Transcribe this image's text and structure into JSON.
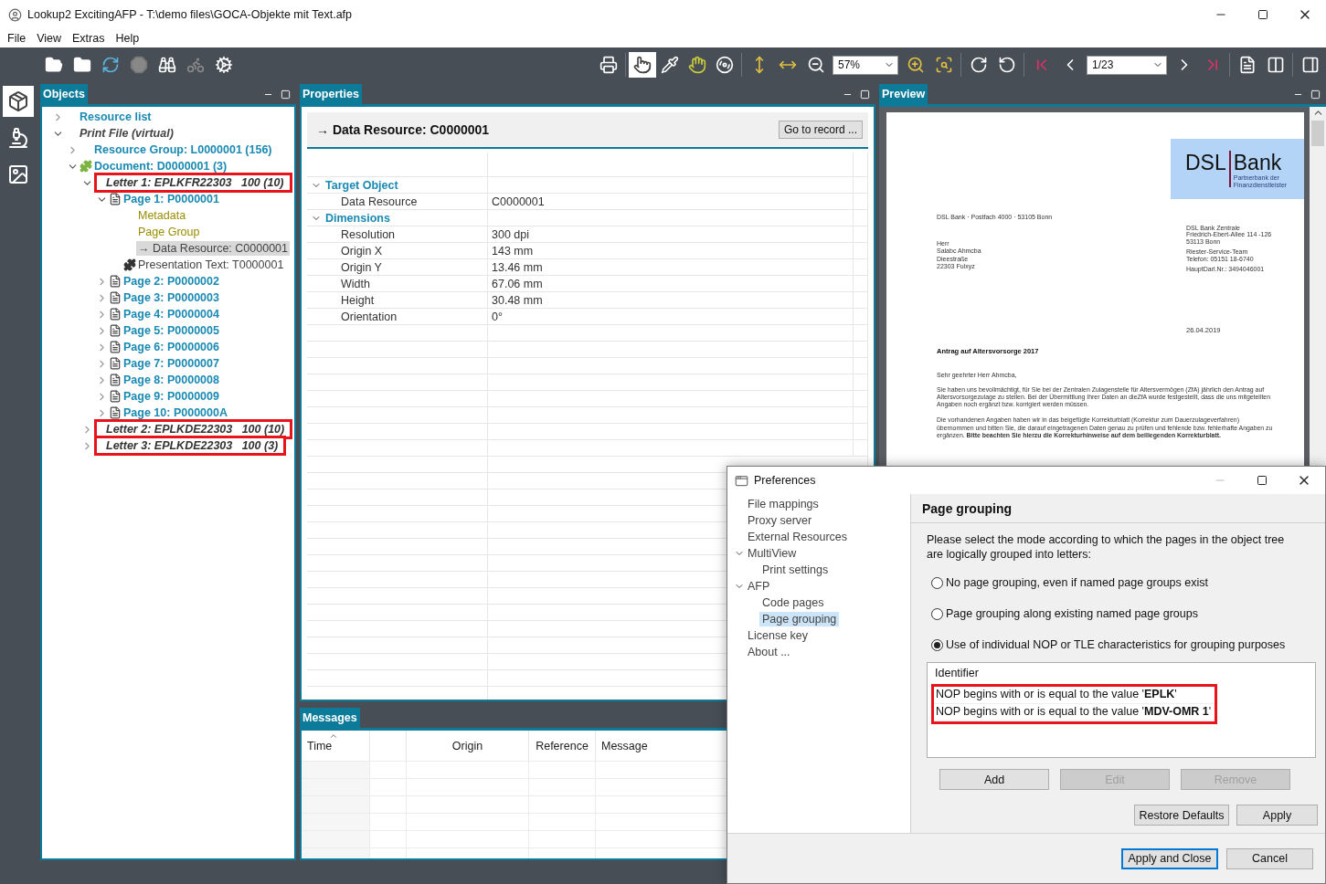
{
  "window": {
    "title": "Lookup2 ExcitingAFP - T:\\demo files\\GOCA-Objekte mit Text.afp"
  },
  "menu": [
    "File",
    "View",
    "Extras",
    "Help"
  ],
  "toolbar": {
    "zoom": "57%",
    "page": "1/23",
    "tools": [
      {
        "selected": true
      },
      {
        "selected": false
      },
      {
        "selected": false
      },
      {
        "selected": false
      }
    ]
  },
  "side_tabs": [
    {
      "selected": true
    },
    {
      "selected": false
    },
    {
      "selected": false
    }
  ],
  "objects": {
    "title": "Objects",
    "tree": [
      {
        "label": "Resource list",
        "kind": "node",
        "selected": false,
        "highlighted": false,
        "expanded": false
      },
      {
        "label": "Print File (virtual)",
        "kind": "virtual",
        "selected": false,
        "highlighted": false,
        "expanded": true,
        "children": [
          {
            "label": "Resource Group: L0000001 (156)",
            "kind": "node",
            "selected": false,
            "highlighted": false,
            "expanded": false
          },
          {
            "label": "Document: D0000001 (3)",
            "kind": "document",
            "selected": false,
            "highlighted": false,
            "expanded": true,
            "children": [
              {
                "label": "Letter 1: EPLKFR22303   100 (10)",
                "kind": "letter",
                "selected": false,
                "highlighted": true,
                "expanded": true,
                "children": [
                  {
                    "label": "Page 1: P0000001",
                    "kind": "page",
                    "selected": false,
                    "highlighted": false,
                    "expanded": true,
                    "children": [
                      {
                        "label": "Metadata",
                        "kind": "meta",
                        "selected": false,
                        "highlighted": false
                      },
                      {
                        "label": "Page Group",
                        "kind": "meta",
                        "selected": false,
                        "highlighted": false
                      },
                      {
                        "label": "→ Data Resource: C0000001",
                        "kind": "data",
                        "selected": true,
                        "highlighted": false
                      },
                      {
                        "label": "Presentation Text: T0000001",
                        "kind": "object",
                        "selected": false,
                        "highlighted": false
                      }
                    ]
                  },
                  {
                    "label": "Page 2: P0000002",
                    "kind": "page",
                    "selected": false,
                    "highlighted": false,
                    "expanded": false
                  },
                  {
                    "label": "Page 3: P0000003",
                    "kind": "page",
                    "selected": false,
                    "highlighted": false,
                    "expanded": false
                  },
                  {
                    "label": "Page 4: P0000004",
                    "kind": "page",
                    "selected": false,
                    "highlighted": false,
                    "expanded": false
                  },
                  {
                    "label": "Page 5: P0000005",
                    "kind": "page",
                    "selected": false,
                    "highlighted": false,
                    "expanded": false
                  },
                  {
                    "label": "Page 6: P0000006",
                    "kind": "page",
                    "selected": false,
                    "highlighted": false,
                    "expanded": false
                  },
                  {
                    "label": "Page 7: P0000007",
                    "kind": "page",
                    "selected": false,
                    "highlighted": false,
                    "expanded": false
                  },
                  {
                    "label": "Page 8: P0000008",
                    "kind": "page",
                    "selected": false,
                    "highlighted": false,
                    "expanded": false
                  },
                  {
                    "label": "Page 9: P0000009",
                    "kind": "page",
                    "selected": false,
                    "highlighted": false,
                    "expanded": false
                  },
                  {
                    "label": "Page 10: P000000A",
                    "kind": "page",
                    "selected": false,
                    "highlighted": false,
                    "expanded": false
                  }
                ]
              },
              {
                "label": "Letter 2: EPLKDE22303   100 (10)",
                "kind": "letter",
                "selected": false,
                "highlighted": true,
                "expanded": false
              },
              {
                "label": "Letter 3: EPLKDE22303   100 (3)",
                "kind": "letter",
                "selected": false,
                "highlighted": true,
                "expanded": false
              }
            ]
          }
        ]
      }
    ]
  },
  "properties": {
    "title": "Properties",
    "heading": "→ Data Resource: C0000001",
    "button": "Go to record ...",
    "sections": [
      {
        "label": "Target Object",
        "expanded": true,
        "rows": [
          {
            "name": "Data Resource",
            "value": "C0000001"
          }
        ]
      },
      {
        "label": "Dimensions",
        "expanded": true,
        "rows": [
          {
            "name": "Resolution",
            "value": "300 dpi"
          },
          {
            "name": "Origin X",
            "value": "143 mm"
          },
          {
            "name": "Origin Y",
            "value": "13.46 mm"
          },
          {
            "name": "Width",
            "value": "67.06 mm"
          },
          {
            "name": "Height",
            "value": "30.48 mm"
          },
          {
            "name": "Orientation",
            "value": "0°"
          }
        ]
      }
    ]
  },
  "preview": {
    "title": "Preview",
    "document": {
      "logo": {
        "name": "DSL",
        "name_2": "Bank",
        "tagline": [
          "Partnerbank der",
          "Finanzdienstleister"
        ]
      },
      "sender_line": "DSL Bank · Postfach 4000 · 53105 Bonn",
      "recipient": [
        "Herr",
        "Salabc Ahmcba",
        "Dieestraße",
        "22303 Fulxyz"
      ],
      "contact": [
        [
          "DSL Bank Zentrale",
          "Friedrich-Ebert-Allee 114 -126",
          "53113 Bonn"
        ],
        [
          "Riester-Service-Team",
          "Telefon: 05151 18-6740"
        ],
        [
          "HauptDarl.Nr.: 3494046001"
        ]
      ],
      "date": "26.04.2019",
      "subject": "Antrag auf Altersvorsorge 2017",
      "salutation": "Sehr geehrter Herr Ahmcba,",
      "paragraphs": [
        "Sie haben uns bevollmächtigt, für Sie bei der Zentralen Zulagenstelle für Altersvermögen (ZfA) jährlich den Antrag auf Altersvorsorgezulage zu stellen. Bei der Übermittlung Ihrer Daten an dieZfA wurde festgestellt, dass die uns mitgeteilten Angaben noch ergänzt bzw. korrigiert werden müssen.",
        "Die vorhandenen Angaben haben wir in das beigefügte Korrekturblatt (Korrektur zum Dauerzulageverfahren) übernommen und bitten Sie, die darauf eingetragenen Daten genau zu prüfen und fehlende bzw. fehlerhafte Angaben zu ergänzen. **Bitte beachten Sie hierzu die Korrekturhinweise auf dem beiliegenden Korrekturblatt.**"
      ]
    }
  },
  "messages": {
    "title": "Messages",
    "columns": [
      {
        "label": "Time",
        "sorted": true
      },
      {
        "label": "Origin",
        "sorted": false
      },
      {
        "label": "Reference",
        "sorted": false
      },
      {
        "label": "Message",
        "sorted": false
      }
    ]
  },
  "dialog": {
    "title": "Preferences",
    "nav": [
      {
        "label": "File mappings",
        "selected": false
      },
      {
        "label": "Proxy server",
        "selected": false
      },
      {
        "label": "External Resources",
        "selected": false
      },
      {
        "label": "MultiView",
        "selected": false,
        "expanded": true,
        "children": [
          {
            "label": "Print settings",
            "selected": false
          }
        ]
      },
      {
        "label": "AFP",
        "selected": false,
        "expanded": true,
        "children": [
          {
            "label": "Code pages",
            "selected": false
          },
          {
            "label": "Page grouping",
            "selected": true
          }
        ]
      },
      {
        "label": "License key",
        "selected": false
      },
      {
        "label": "About ...",
        "selected": false
      }
    ],
    "heading": "Page grouping",
    "description": "Please select the mode according to which the pages in the object tree are logically grouped into letters:",
    "options": [
      {
        "label": "No page grouping, even if named page groups exist",
        "selected": false
      },
      {
        "label": "Page grouping along existing named page groups",
        "selected": false
      },
      {
        "label": "Use of individual NOP or TLE characteristics for grouping purposes",
        "selected": true
      }
    ],
    "table_header": "Identifier",
    "identifiers": [
      {
        "text": "NOP begins with or is equal to the value '**EPLK**'",
        "highlighted": true
      },
      {
        "text": "NOP begins with or is equal to the value '**MDV-OMR 1**'",
        "highlighted": true
      }
    ],
    "list_buttons": [
      {
        "label": "Add",
        "disabled": false
      },
      {
        "label": "Edit",
        "disabled": true
      },
      {
        "label": "Remove",
        "disabled": true
      }
    ],
    "page_buttons": [
      "Restore Defaults",
      "Apply"
    ],
    "footer_buttons": [
      {
        "label": "Apply and Close",
        "default": true
      },
      {
        "label": "Cancel",
        "default": false
      }
    ]
  }
}
